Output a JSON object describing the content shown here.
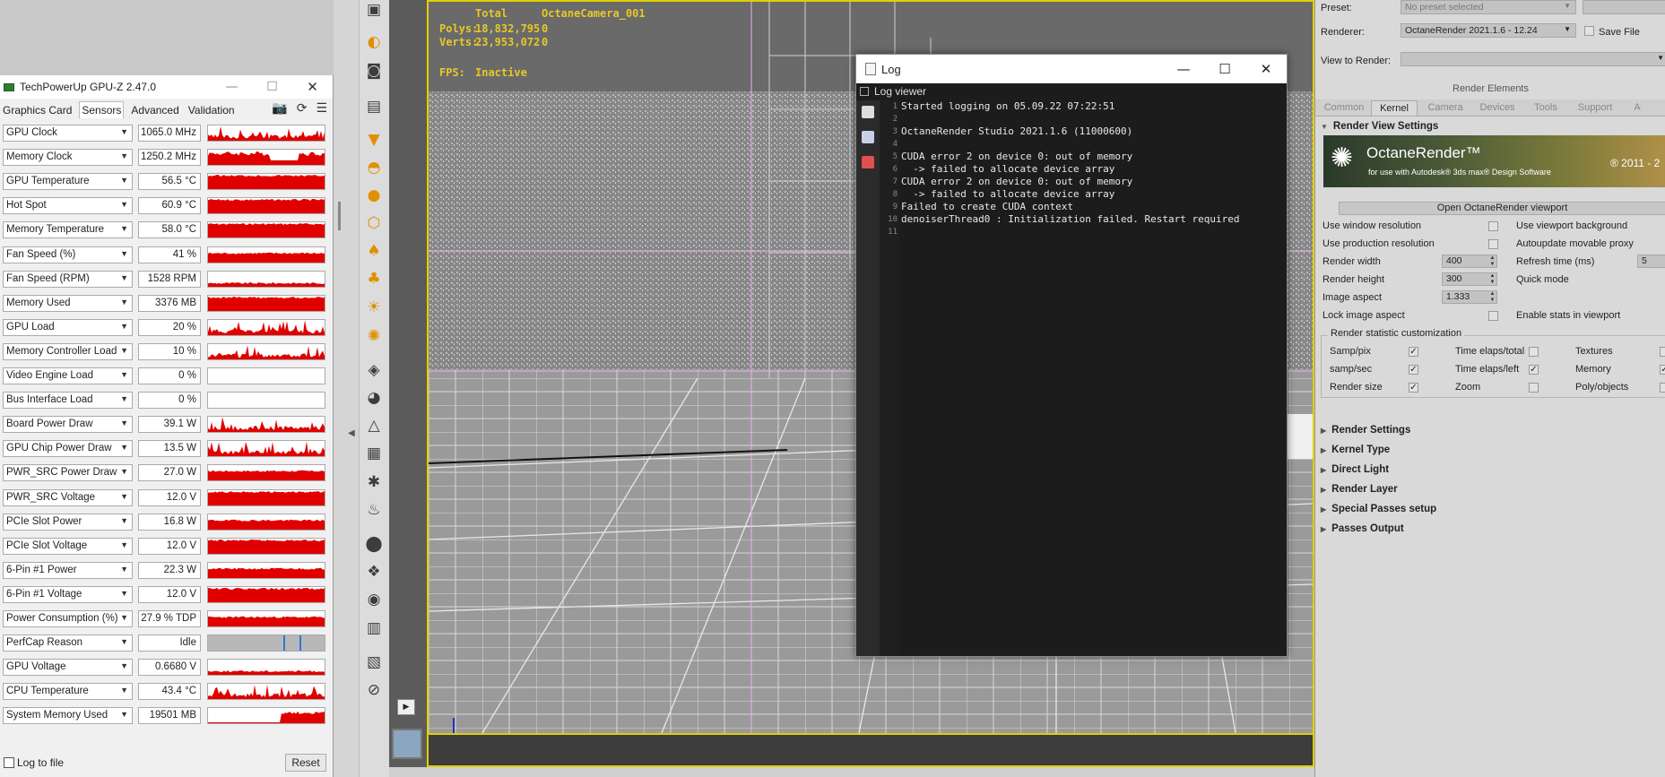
{
  "gpuz": {
    "title": "TechPowerUp GPU-Z 2.47.0",
    "tabs": [
      "Graphics Card",
      "Sensors",
      "Advanced",
      "Validation"
    ],
    "active_tab": "Sensors",
    "sensors": [
      {
        "label": "GPU Clock",
        "value": "1065.0 MHz",
        "graph": "spiky"
      },
      {
        "label": "Memory Clock",
        "value": "1250.2 MHz",
        "graph": "block"
      },
      {
        "label": "GPU Temperature",
        "value": "56.5 °C",
        "graph": "full"
      },
      {
        "label": "Hot Spot",
        "value": "60.9 °C",
        "graph": "full"
      },
      {
        "label": "Memory Temperature",
        "value": "58.0 °C",
        "graph": "full"
      },
      {
        "label": "Fan Speed (%)",
        "value": "41 %",
        "graph": "mid"
      },
      {
        "label": "Fan Speed (RPM)",
        "value": "1528 RPM",
        "graph": "low"
      },
      {
        "label": "Memory Used",
        "value": "3376 MB",
        "graph": "full"
      },
      {
        "label": "GPU Load",
        "value": "20 %",
        "graph": "spiky"
      },
      {
        "label": "Memory Controller Load",
        "value": "10 %",
        "graph": "spiky"
      },
      {
        "label": "Video Engine Load",
        "value": "0 %",
        "graph": "none"
      },
      {
        "label": "Bus Interface Load",
        "value": "0 %",
        "graph": "none"
      },
      {
        "label": "Board Power Draw",
        "value": "39.1 W",
        "graph": "spiky"
      },
      {
        "label": "GPU Chip Power Draw",
        "value": "13.5 W",
        "graph": "spiky"
      },
      {
        "label": "PWR_SRC Power Draw",
        "value": "27.0 W",
        "graph": "mid"
      },
      {
        "label": "PWR_SRC Voltage",
        "value": "12.0 V",
        "graph": "full"
      },
      {
        "label": "PCIe Slot Power",
        "value": "16.8 W",
        "graph": "mid"
      },
      {
        "label": "PCIe Slot Voltage",
        "value": "12.0 V",
        "graph": "full"
      },
      {
        "label": "6-Pin #1 Power",
        "value": "22.3 W",
        "graph": "mid"
      },
      {
        "label": "6-Pin #1 Voltage",
        "value": "12.0 V",
        "graph": "full"
      },
      {
        "label": "Power Consumption (%)",
        "value": "27.9 % TDP",
        "graph": "mid"
      },
      {
        "label": "PerfCap Reason",
        "value": "Idle",
        "graph": "perfcap"
      },
      {
        "label": "GPU Voltage",
        "value": "0.6680 V",
        "graph": "low"
      },
      {
        "label": "CPU Temperature",
        "value": "43.4 °C",
        "graph": "spiky"
      },
      {
        "label": "System Memory Used",
        "value": "19501 MB",
        "graph": "tail"
      }
    ],
    "log_to_file_label": "Log to file",
    "reset_label": "Reset",
    "graph_color": "#e00000"
  },
  "viewport": {
    "stats": {
      "total_label": "Total",
      "camera": "OctaneCamera_001",
      "polys_label": "Polys:",
      "polys_value": "18,832,795",
      "polys_extra": "0",
      "verts_label": "Verts:",
      "verts_value": "23,953,072",
      "verts_extra": "0",
      "fps_label": "FPS:",
      "fps_value": "Inactive"
    },
    "accent": "#e0d000"
  },
  "log_window": {
    "title": "Log",
    "viewer_label": "Log viewer",
    "lines": [
      "Started logging on 05.09.22 07:22:51",
      "",
      "OctaneRender Studio 2021.1.6 (11000600)",
      "",
      "CUDA error 2 on device 0: out of memory",
      "  -> failed to allocate device array",
      "CUDA error 2 on device 0: out of memory",
      "  -> failed to allocate device array",
      "Failed to create CUDA context",
      "denoiserThread0 : Initialization failed. Restart required",
      ""
    ]
  },
  "render_panel": {
    "preset_label": "Preset:",
    "preset_value": "No preset selected",
    "renderer_label": "Renderer:",
    "renderer_value": "OctaneRender 2021.1.6 - 12.24",
    "save_file_label": "Save File",
    "view_label": "View to Render:",
    "render_elements": "Render Elements",
    "tabs": [
      "Common",
      "Kernel",
      "Camera",
      "Devices",
      "Tools",
      "Support",
      "A"
    ],
    "active_tab": "Kernel",
    "section_title": "Render View Settings",
    "banner": {
      "brand": "OctaneRender™",
      "sub": "for use with Autodesk® 3ds max® Design Software",
      "year": "® 2011 - 2"
    },
    "open_viewport_label": "Open OctaneRender viewport",
    "left_settings": [
      {
        "label": "Use window resolution"
      },
      {
        "label": "Use production resolution"
      },
      {
        "label": "Render width",
        "value": "400"
      },
      {
        "label": "Render height",
        "value": "300"
      },
      {
        "label": "Image aspect",
        "value": "1.333"
      },
      {
        "label": "Lock image aspect"
      }
    ],
    "right_settings": [
      "Use viewport background",
      "Autoupdate movable proxy",
      "Refresh time (ms)",
      "Quick mode",
      "",
      "Enable stats in viewport"
    ],
    "refresh_value": "5",
    "stats_group": "Render statistic customization",
    "stats_grid": [
      [
        "Samp/pix",
        "Time elaps/total",
        "Textures"
      ],
      [
        "samp/sec",
        "Time elaps/left",
        "Memory"
      ],
      [
        "Render size",
        "Zoom",
        "Poly/objects"
      ]
    ],
    "collapsed_sections": [
      "Render Settings",
      "Kernel Type",
      "Direct Light",
      "Render Layer",
      "Special Passes setup",
      "Passes Output"
    ]
  }
}
